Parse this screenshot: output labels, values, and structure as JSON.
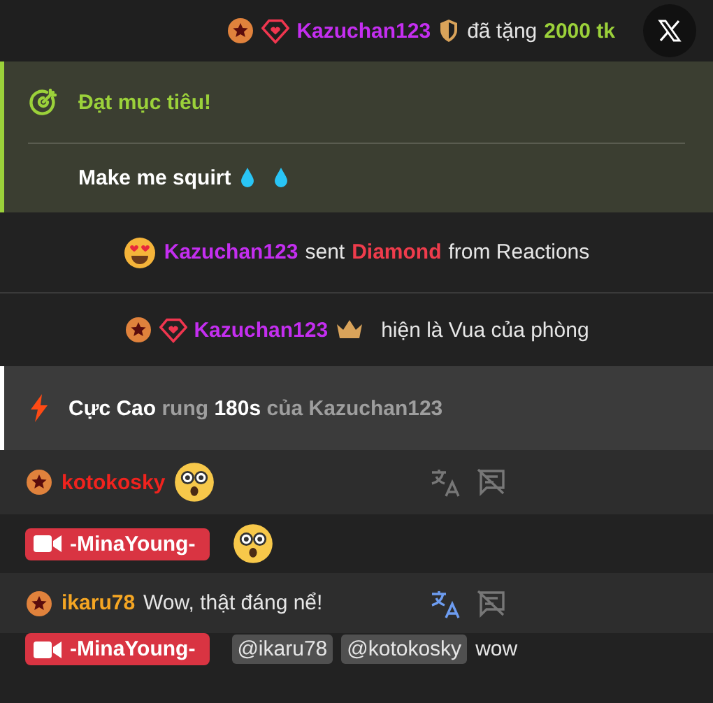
{
  "tip_bar": {
    "user": "Kazuchan123",
    "color": "#c42ef0",
    "text": "đã tặng",
    "amount": "2000 tk"
  },
  "goal": {
    "title": "Đạt mục tiêu!",
    "text": "Make me squirt"
  },
  "events": [
    {
      "kind": "reaction",
      "user": "Kazuchan123",
      "verb": "sent",
      "item": "Diamond",
      "tail": "from Reactions"
    },
    {
      "kind": "king",
      "user": "Kazuchan123",
      "text": "hiện là Vua của phòng"
    },
    {
      "kind": "vibe",
      "level_name": "Cực Cao",
      "verb": "rung",
      "duration": "180s",
      "tail": "của Kazuchan123"
    }
  ],
  "messages": [
    {
      "kind": "user",
      "user": "kotokosky",
      "color": "#f0231e",
      "emoji": true,
      "translated": false
    },
    {
      "kind": "broadcaster",
      "user": "-MinaYoung-",
      "emoji": true
    },
    {
      "kind": "user",
      "user": "ikaru78",
      "color": "#f5a623",
      "text": "Wow, thật đáng nể!",
      "translated": true
    },
    {
      "kind": "broadcaster",
      "user": "-MinaYoung-",
      "mentions": [
        "@ikaru78",
        "@kotokosky"
      ],
      "text": "wow"
    }
  ]
}
